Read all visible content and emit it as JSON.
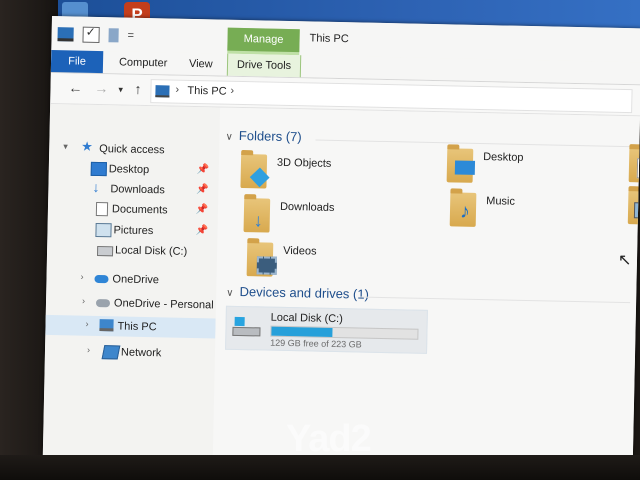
{
  "window": {
    "title": "This PC"
  },
  "ribbon": {
    "context_tab": "Manage",
    "tabs": {
      "file": "File",
      "computer": "Computer",
      "view": "View",
      "drive_tools": "Drive Tools"
    },
    "qat_separator": "="
  },
  "addressbar": {
    "back": "←",
    "forward": "→",
    "recent": "▾",
    "up": "↑",
    "sep": "›",
    "crumb": "This PC"
  },
  "navpane": {
    "quick_access": "Quick access",
    "items": [
      {
        "label": "Desktop",
        "icon": "desktop-icon",
        "pinned": true
      },
      {
        "label": "Downloads",
        "icon": "downloads-icon",
        "pinned": true
      },
      {
        "label": "Documents",
        "icon": "documents-icon",
        "pinned": true
      },
      {
        "label": "Pictures",
        "icon": "pictures-icon",
        "pinned": true
      },
      {
        "label": "Local Disk (C:)",
        "icon": "drive-icon",
        "pinned": false
      }
    ],
    "onedrive": "OneDrive",
    "onedrive_personal": "OneDrive - Personal",
    "this_pc": "This PC",
    "network": "Network",
    "pin_glyph": "📌"
  },
  "content": {
    "folders_header": "Folders (7)",
    "folders": [
      {
        "label": "3D Objects",
        "icon": "3d-objects-icon"
      },
      {
        "label": "Desktop",
        "icon": "desktop-folder-icon"
      },
      {
        "label": "Downloads",
        "icon": "downloads-folder-icon"
      },
      {
        "label": "Music",
        "icon": "music-folder-icon"
      },
      {
        "label": "Videos",
        "icon": "videos-folder-icon"
      }
    ],
    "devices_header": "Devices and drives (1)",
    "drive": {
      "name": "Local Disk (C:)",
      "free_text": "129 GB free of 223 GB",
      "used_fraction": 0.42
    }
  },
  "overlay": {
    "watermark": "Yad2"
  },
  "colors": {
    "file_tab": "#1c62b9",
    "manage_tab": "#77ad54",
    "selection": "#d9e8f5",
    "drive_bar": "#26a0da"
  }
}
